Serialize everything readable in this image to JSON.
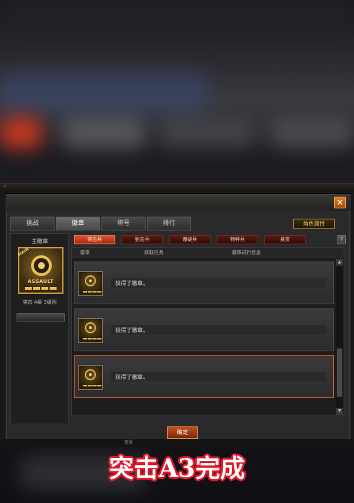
{
  "tabs": [
    "挑战",
    "徽章",
    "称号",
    "排行"
  ],
  "active_tab": "徽章",
  "attr_button": "角色属性",
  "close_label": "×",
  "main_badge": {
    "title": "主徽章",
    "main_tag": "MAIN",
    "word": "ASSAULT",
    "level": "突击 A级 3级别"
  },
  "sub_tabs": [
    "突击兵",
    "狙击兵",
    "爆破兵",
    "特种兵",
    "悬赏"
  ],
  "active_sub_tab": "突击兵",
  "help_label": "?",
  "columns": [
    "徽章",
    "获取任务",
    "徽章进行信息"
  ],
  "rows": [
    {
      "text": "获得了徽章。",
      "selected": false
    },
    {
      "text": "获得了徽章。",
      "selected": false
    },
    {
      "text": "获得了徽章。",
      "selected": true
    }
  ],
  "confirm_button": "确定",
  "bottom_text": "普通",
  "caption": "突击A3完成",
  "colors": {
    "accent": "#d56a3a",
    "caption_outline": "#e0182a",
    "gold": "#e8c050"
  }
}
